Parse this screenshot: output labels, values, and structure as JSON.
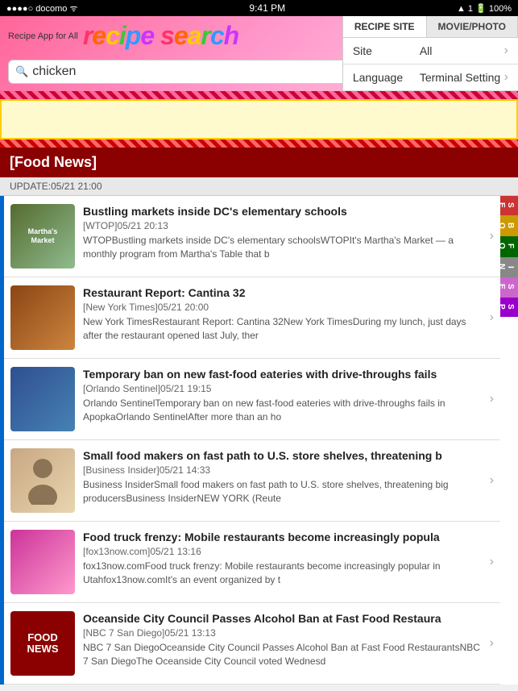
{
  "statusBar": {
    "carrier": "docomo",
    "time": "9:41 PM",
    "battery": "100%",
    "signal": "▲ 1"
  },
  "header": {
    "appForAll": "Recipe App for All",
    "titleText": "recipe search",
    "searchInput": "chicken",
    "searchPlaceholder": "chicken",
    "searchButtonLabel": "Search"
  },
  "tabs": {
    "recipeSite": "RECIPE SITE",
    "moviePhoto": "MOVIE/PHOTO"
  },
  "settings": [
    {
      "label": "Site",
      "value": "All"
    },
    {
      "label": "Language",
      "value": "Terminal Setting"
    }
  ],
  "foodNews": {
    "sectionTitle": "[Food News]",
    "updateText": "UPDATE:05/21 21:00"
  },
  "sideNav": [
    {
      "label": "SEARCH",
      "class": "search"
    },
    {
      "label": "BOOKMARK",
      "class": "bookmark"
    },
    {
      "label": "FOOD\nNEWS",
      "class": "foodnews"
    },
    {
      "label": "INFO",
      "class": "info"
    },
    {
      "label": "SETTING",
      "class": "setting"
    },
    {
      "label": "SPECIAL",
      "class": "special"
    }
  ],
  "newsItems": [
    {
      "title": "Bustling markets inside DC's elementary schools",
      "source": "[WTOP]",
      "date": "05/21 20:13",
      "snippet": "WTOPBustling markets inside DC's elementary schoolsWTOPIt's Martha's Market — a monthly program from Martha's Table that b",
      "thumbClass": "thumb-market",
      "thumbText": "Martha's Market"
    },
    {
      "title": "Restaurant Report: Cantina 32",
      "source": "[New York Times]",
      "date": "05/21 20:00",
      "snippet": "New York TimesRestaurant Report: Cantina 32New York TimesDuring my lunch, just days after the restaurant opened last July, ther",
      "thumbClass": "thumb-restaurant",
      "thumbText": ""
    },
    {
      "title": "Temporary ban on new fast-food eateries with drive-throughs fails",
      "source": "[Orlando Sentinel]",
      "date": "05/21 19:15",
      "snippet": "Orlando SentinelTemporary ban on new fast-food eateries with drive-throughs fails in ApopkaOrlando SentinelAfter more than an ho",
      "thumbClass": "thumb-fastfood",
      "thumbText": ""
    },
    {
      "title": "Small food makers on fast path to U.S. store shelves, threatening b",
      "source": "[Business Insider]",
      "date": "05/21 14:33",
      "snippet": "Business InsiderSmall food makers on fast path to U.S. store shelves, threatening big producersBusiness InsiderNEW YORK (Reute",
      "thumbClass": "thumb-person",
      "thumbText": ""
    },
    {
      "title": "Food truck frenzy: Mobile restaurants become increasingly popula",
      "source": "[fox13now.com]",
      "date": "05/21 13:16",
      "snippet": "fox13now.comFood truck frenzy: Mobile restaurants become increasingly popular in Utahfox13now.comIt's an event organized by t",
      "thumbClass": "thumb-truck",
      "thumbText": ""
    },
    {
      "title": "Oceanside City Council Passes Alcohol Ban at Fast Food Restaura",
      "source": "[NBC 7 San Diego]",
      "date": "05/21 13:13",
      "snippet": "NBC 7 San DiegoOceanside City Council Passes Alcohol Ban at Fast Food RestaurantsNBC 7 San DiegoThe Oceanside City Council voted Wednesd",
      "thumbClass": "thumb-foodnews",
      "thumbText": "FOOD\nNEWS"
    }
  ]
}
